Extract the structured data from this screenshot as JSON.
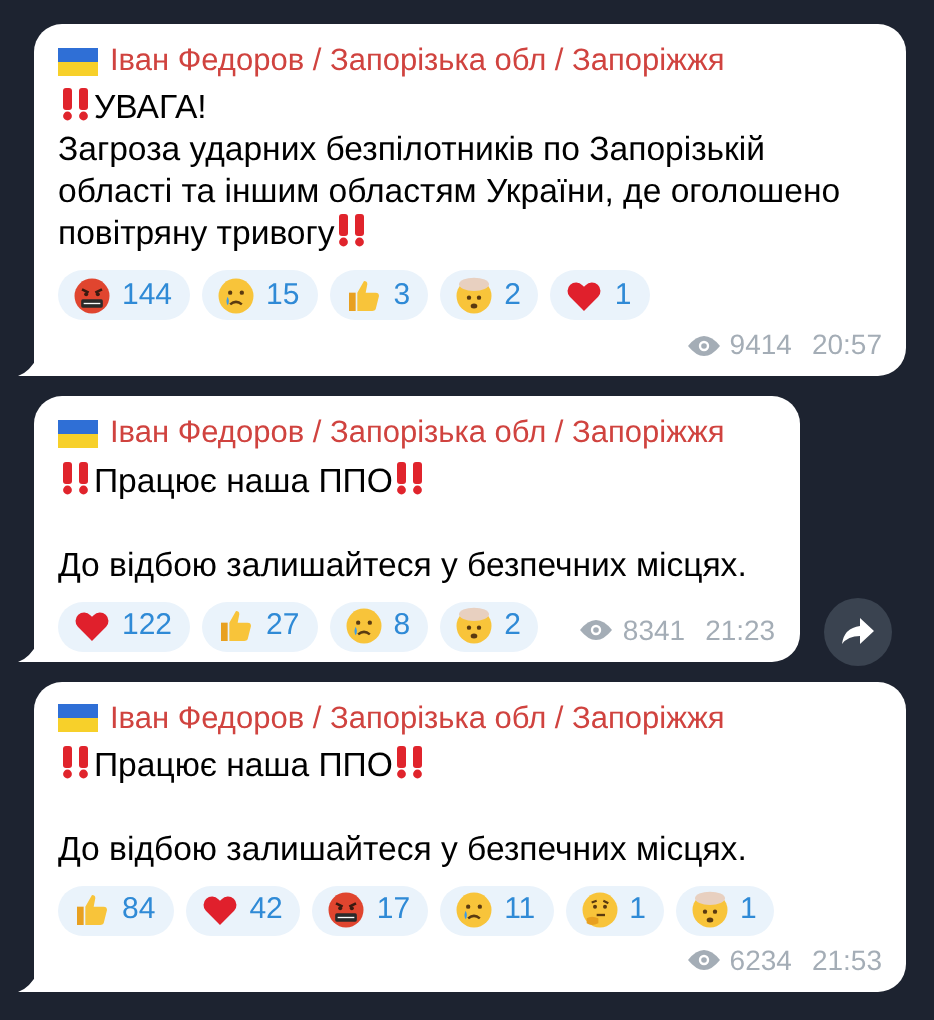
{
  "messages": [
    {
      "author": "Іван Федоров / Запорізька обл / Запоріжжя",
      "paragraphs": [
        {
          "text": "УВАГА!",
          "alert_before": true,
          "alert_after": false,
          "blank_line_before": false
        },
        {
          "text": "Загроза ударних безпілотників по Запорізькій області та іншим областям України, де оголошено повітряну тривогу",
          "alert_before": false,
          "alert_after": true,
          "blank_line_before": false
        }
      ],
      "reactions": [
        {
          "kind": "angry",
          "count": "144"
        },
        {
          "kind": "crying",
          "count": "15"
        },
        {
          "kind": "thumbs",
          "count": "3"
        },
        {
          "kind": "exploding",
          "count": "2"
        },
        {
          "kind": "heart",
          "count": "1"
        }
      ],
      "views": "9414",
      "time": "20:57",
      "forward": false
    },
    {
      "author": "Іван Федоров / Запорізька обл / Запоріжжя",
      "paragraphs": [
        {
          "text": "Працює наша ППО",
          "alert_before": true,
          "alert_after": true,
          "blank_line_before": false
        },
        {
          "text": "До відбою залишайтеся у безпечних місцях.",
          "alert_before": false,
          "alert_after": false,
          "blank_line_before": true
        }
      ],
      "reactions": [
        {
          "kind": "heart",
          "count": "122"
        },
        {
          "kind": "thumbs",
          "count": "27"
        },
        {
          "kind": "crying",
          "count": "8"
        },
        {
          "kind": "exploding",
          "count": "2"
        }
      ],
      "views": "8341",
      "time": "21:23",
      "forward": true
    },
    {
      "author": "Іван Федоров / Запорізька обл / Запоріжжя",
      "paragraphs": [
        {
          "text": "Працює наша ППО",
          "alert_before": true,
          "alert_after": true,
          "blank_line_before": false
        },
        {
          "text": "До відбою залишайтеся у безпечних місцях.",
          "alert_before": false,
          "alert_after": false,
          "blank_line_before": true
        }
      ],
      "reactions": [
        {
          "kind": "thumbs",
          "count": "84"
        },
        {
          "kind": "heart",
          "count": "42"
        },
        {
          "kind": "angry",
          "count": "17"
        },
        {
          "kind": "crying",
          "count": "11"
        },
        {
          "kind": "thinking",
          "count": "1"
        },
        {
          "kind": "exploding",
          "count": "1"
        }
      ],
      "views": "6234",
      "time": "21:53",
      "forward": false
    }
  ]
}
